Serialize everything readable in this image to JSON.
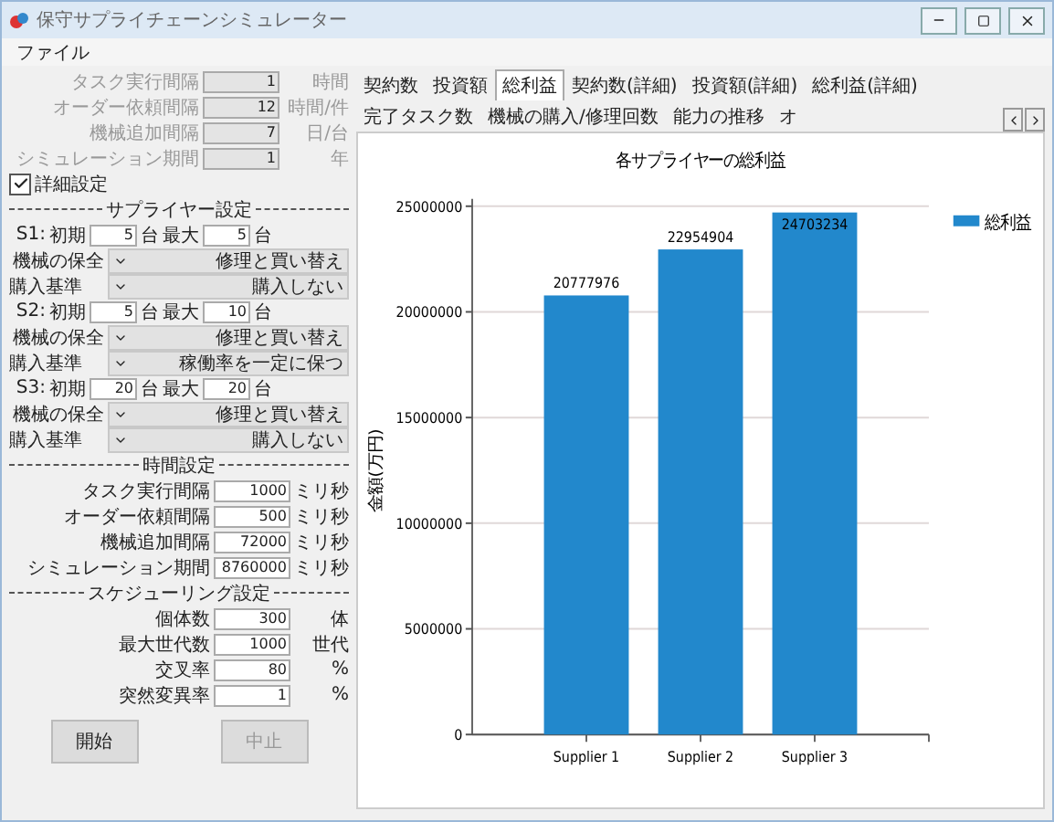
{
  "window": {
    "title": "保守サプライチェーンシミュレーター"
  },
  "menu": [
    {
      "label": "ファイル"
    }
  ],
  "basic_settings": [
    {
      "label": "タスク実行間隔",
      "value": "1",
      "unit": "時間",
      "disabled": true
    },
    {
      "label": "オーダー依頼間隔",
      "value": "12",
      "unit": "時間/件",
      "disabled": true
    },
    {
      "label": "機械追加間隔",
      "value": "7",
      "unit": "日/台",
      "disabled": true
    },
    {
      "label": "シミュレーション期間",
      "value": "1",
      "unit": "年",
      "disabled": true
    }
  ],
  "detail_settings": {
    "label": "詳細設定",
    "checked": true
  },
  "supplier_section": {
    "title": "サプライヤー設定",
    "suppliers": [
      {
        "name": "S1:",
        "initial_label": "初期",
        "initial": "5",
        "initial_unit": "台",
        "max_label": "最大",
        "max": "5",
        "max_unit": "台",
        "maintenance_label": "機械の保全",
        "maintenance": "修理と買い替え",
        "purchase_label": "購入基準",
        "purchase": "購入しない"
      },
      {
        "name": "S2:",
        "initial_label": "初期",
        "initial": "5",
        "initial_unit": "台",
        "max_label": "最大",
        "max": "10",
        "max_unit": "台",
        "maintenance_label": "機械の保全",
        "maintenance": "修理と買い替え",
        "purchase_label": "購入基準",
        "purchase": "稼働率を一定に保つ"
      },
      {
        "name": "S3:",
        "initial_label": "初期",
        "initial": "20",
        "initial_unit": "台",
        "max_label": "最大",
        "max": "20",
        "max_unit": "台",
        "maintenance_label": "機械の保全",
        "maintenance": "修理と買い替え",
        "purchase_label": "購入基準",
        "purchase": "購入しない"
      }
    ]
  },
  "time_section": {
    "title": "時間設定",
    "fields": [
      {
        "label": "タスク実行間隔",
        "value": "1000",
        "unit": "ミリ秒"
      },
      {
        "label": "オーダー依頼間隔",
        "value": "500",
        "unit": "ミリ秒"
      },
      {
        "label": "機械追加間隔",
        "value": "72000",
        "unit": "ミリ秒"
      },
      {
        "label": "シミュレーション期間",
        "value": "8760000",
        "unit": "ミリ秒"
      }
    ]
  },
  "scheduling_section": {
    "title": "スケジューリング設定",
    "fields": [
      {
        "label": "個体数",
        "value": "300",
        "unit": "体"
      },
      {
        "label": "最大世代数",
        "value": "1000",
        "unit": "世代"
      },
      {
        "label": "交叉率",
        "value": "80",
        "unit": "%"
      },
      {
        "label": "突然変異率",
        "value": "1",
        "unit": "%"
      }
    ]
  },
  "buttons": [
    {
      "label": "開始",
      "disabled": false
    },
    {
      "label": "中止",
      "disabled": true
    }
  ],
  "tabs": [
    {
      "label": "契約数",
      "selected": false
    },
    {
      "label": "投資額",
      "selected": false
    },
    {
      "label": "総利益",
      "selected": true
    },
    {
      "label": "契約数(詳細)",
      "selected": false
    },
    {
      "label": "投資額(詳細)",
      "selected": false
    },
    {
      "label": "総利益(詳細)",
      "selected": false
    },
    {
      "label": "完了タスク数",
      "selected": false
    },
    {
      "label": "機械の購入/修理回数",
      "selected": false
    },
    {
      "label": "能力の推移",
      "selected": false
    },
    {
      "label": "オ",
      "selected": false
    }
  ],
  "chart": {
    "chart_data": {
      "type": "bar",
      "title": "各サプライヤーの総利益",
      "ylabel": "金額(万円)",
      "categories": [
        "Supplier 1",
        "Supplier 2",
        "Supplier 3"
      ],
      "series": [
        {
          "name": "総利益",
          "color": "#2288cc",
          "values": [
            20777976,
            22954904,
            24703234
          ]
        }
      ],
      "ylim": [
        0,
        25000000
      ],
      "yticks": [
        0,
        5000000,
        10000000,
        15000000,
        20000000,
        25000000
      ],
      "data_labels": true,
      "grid": true
    }
  }
}
